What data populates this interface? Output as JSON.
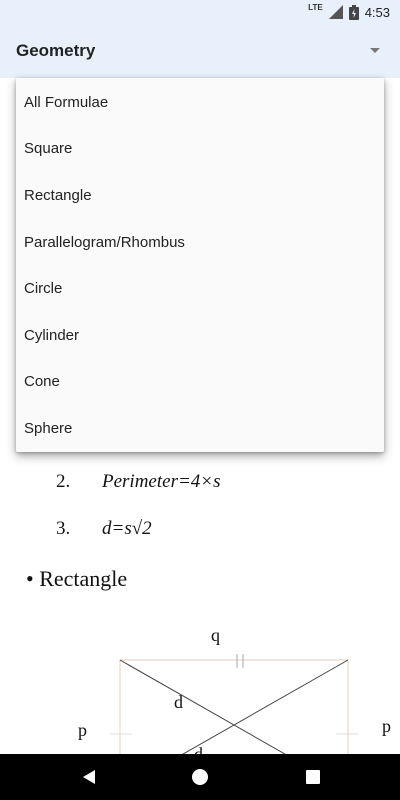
{
  "status_bar": {
    "network": "LTE",
    "time": "4:53",
    "icons": [
      "signal-icon",
      "battery-icon"
    ]
  },
  "app_bar": {
    "title": "Geometry",
    "dropdown_icon": "dropdown-arrow-icon"
  },
  "menu": {
    "items": [
      "All Formulae",
      "Square",
      "Rectangle",
      "Parallelogram/Rhombus",
      "Circle",
      "Cylinder",
      "Cone",
      "Sphere"
    ]
  },
  "content": {
    "formulas": [
      {
        "num": "2.",
        "expr": "Perimeter=4×s"
      },
      {
        "num": "3.",
        "expr": "d=s√2"
      }
    ],
    "section": "• Rectangle",
    "diagram_labels": {
      "top": "q",
      "left": "p",
      "right": "p",
      "diagonal_1": "d",
      "diagonal_2": "d"
    }
  },
  "nav_bar": {
    "icons": [
      "back-icon",
      "home-icon",
      "recent-apps-icon"
    ]
  }
}
